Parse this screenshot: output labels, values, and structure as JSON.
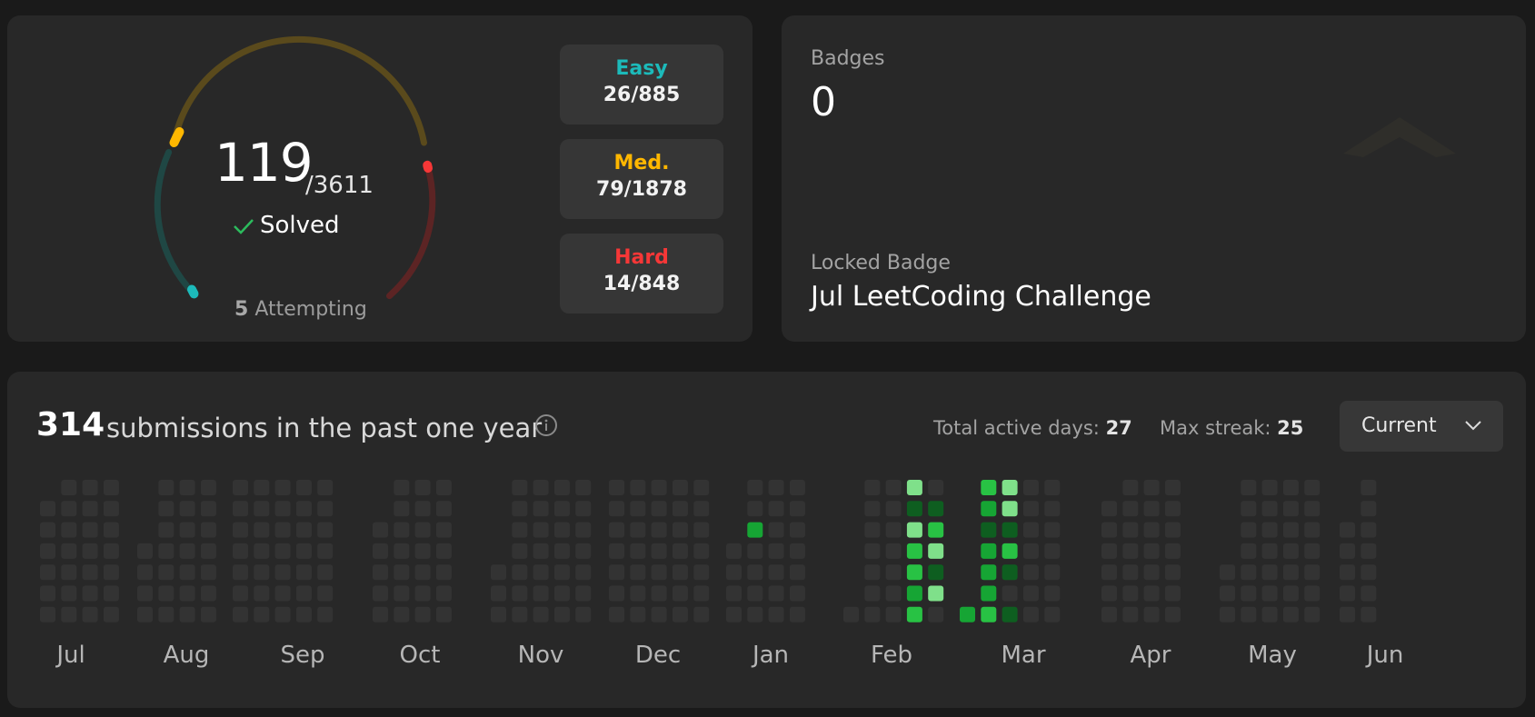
{
  "progress": {
    "solved": "119",
    "total": "/3611",
    "solved_label": "Solved",
    "attempting_count": "5",
    "attempting_label": "Attempting",
    "difficulties": [
      {
        "name": "Easy",
        "value": "26/885",
        "color": "#1cbaba"
      },
      {
        "name": "Med.",
        "value": "79/1878",
        "color": "#ffb700"
      },
      {
        "name": "Hard",
        "value": "14/848",
        "color": "#f63737"
      }
    ]
  },
  "badges": {
    "label": "Badges",
    "count": "0",
    "locked_label": "Locked Badge",
    "locked_name": "Jul LeetCoding Challenge"
  },
  "calendar": {
    "submission_count": "314",
    "submission_text": "submissions in the past one year",
    "active_days_label": "Total active days:",
    "active_days": "27",
    "max_streak_label": "Max streak:",
    "max_streak": "25",
    "range_selector": "Current",
    "months": [
      "Jul",
      "Aug",
      "Sep",
      "Oct",
      "Nov",
      "Dec",
      "Jan",
      "Feb",
      "Mar",
      "Apr",
      "May",
      "Jun"
    ],
    "level_colors": [
      "#333333",
      "#0e5e20",
      "#16a534",
      "#28c244",
      "#7fe08a"
    ]
  }
}
